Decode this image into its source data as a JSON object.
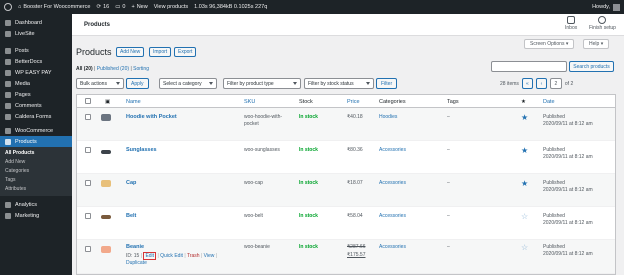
{
  "adminbar": {
    "site_name": "Booster For Woocommerce",
    "updates": "16",
    "comments": "0",
    "new_label": "New",
    "view_products": "View products",
    "metrics": "1.03s  96,384kB  0.1025s  227q",
    "howdy": "Howdy,"
  },
  "sidebar": {
    "items": [
      {
        "label": "Dashboard"
      },
      {
        "label": "LiveSite"
      },
      {
        "label": "Posts"
      },
      {
        "label": "BetterDocs"
      },
      {
        "label": "WP EASY PAY"
      },
      {
        "label": "Media"
      },
      {
        "label": "Pages"
      },
      {
        "label": "Comments"
      },
      {
        "label": "Caldera Forms"
      },
      {
        "label": "WooCommerce"
      },
      {
        "label": "Products"
      }
    ],
    "submenu": [
      "All Products",
      "Add New",
      "Categories",
      "Tags",
      "Attributes"
    ],
    "bottom": [
      {
        "label": "Analytics"
      },
      {
        "label": "Marketing"
      }
    ]
  },
  "topstrip": {
    "page_name": "Products",
    "inbox": "Inbox",
    "finish_setup": "Finish setup"
  },
  "screen_options": "Screen Options",
  "help": "Help",
  "page_title": "Products",
  "buttons": {
    "add_new": "Add New",
    "import": "Import",
    "export": "Export"
  },
  "subsub": {
    "all": "All",
    "all_count": "(20)",
    "published": "Published",
    "published_count": "(20)",
    "sorting": "Sorting",
    "sep": "|"
  },
  "search_button": "Search products",
  "filters": {
    "bulk_actions": "Bulk actions",
    "apply": "Apply",
    "category": "Select a category",
    "product_type": "Filter by product type",
    "stock_status": "Filter by stock status",
    "filter": "Filter"
  },
  "pagination": {
    "items": "28 items",
    "current_page": "2",
    "of": "of 2"
  },
  "columns": {
    "name": "Name",
    "sku": "SKU",
    "stock": "Stock",
    "price": "Price",
    "categories": "Categories",
    "tags": "Tags",
    "date": "Date"
  },
  "rows": [
    {
      "name": "Hoodie with Pocket",
      "sku": "woo-hoodie-with-",
      "sku2": "pocket",
      "stock": "In stock",
      "price": "₹40.18",
      "category": "Hoodies",
      "tags": "–",
      "date1": "Published",
      "date2": "2020/09/11 at 8:12 am",
      "featured": true,
      "thumb": "#6b7480"
    },
    {
      "name": "Sunglasses",
      "sku": "woo-sunglasses",
      "stock": "In stock",
      "price": "₹80.36",
      "category": "Accessories",
      "tags": "–",
      "date1": "Published",
      "date2": "2020/09/11 at 8:12 am",
      "featured": true,
      "thumb": "#3c434a"
    },
    {
      "name": "Cap",
      "sku": "woo-cap",
      "stock": "In stock",
      "price": "₹18.07",
      "category": "Accessories",
      "tags": "–",
      "date1": "Published",
      "date2": "2020/09/11 at 8:12 am",
      "featured": true,
      "thumb": "#e8c07a"
    },
    {
      "name": "Belt",
      "sku": "woo-belt",
      "stock": "In stock",
      "price": "₹58.04",
      "category": "Accessories",
      "tags": "–",
      "date1": "Published",
      "date2": "2020/09/11 at 8:12 am",
      "featured": false,
      "thumb": "#7a5a3c"
    },
    {
      "name": "Beanie",
      "sku": "woo-beanie",
      "stock": "In stock",
      "price_old": "₹287.66",
      "price_new": "₹175.57",
      "category": "Accessories",
      "tags": "–",
      "date1": "Published",
      "date2": "2020/09/11 at 8:12 am",
      "featured": false,
      "thumb": "#f2a98b",
      "row_actions": {
        "id": "ID: 15",
        "edit": "Edit",
        "quick_edit": "Quick Edit",
        "trash": "Trash",
        "view": "View",
        "duplicate": "Duplicate"
      }
    }
  ],
  "icons": {
    "star_filled": "★",
    "star_empty": "☆",
    "featured_header": "★",
    "prev": "‹",
    "first": "«"
  },
  "colors": {
    "accent": "#2271b1",
    "instock": "#00a32a",
    "highlight": "#d63638",
    "sidebar": "#1d2327"
  }
}
